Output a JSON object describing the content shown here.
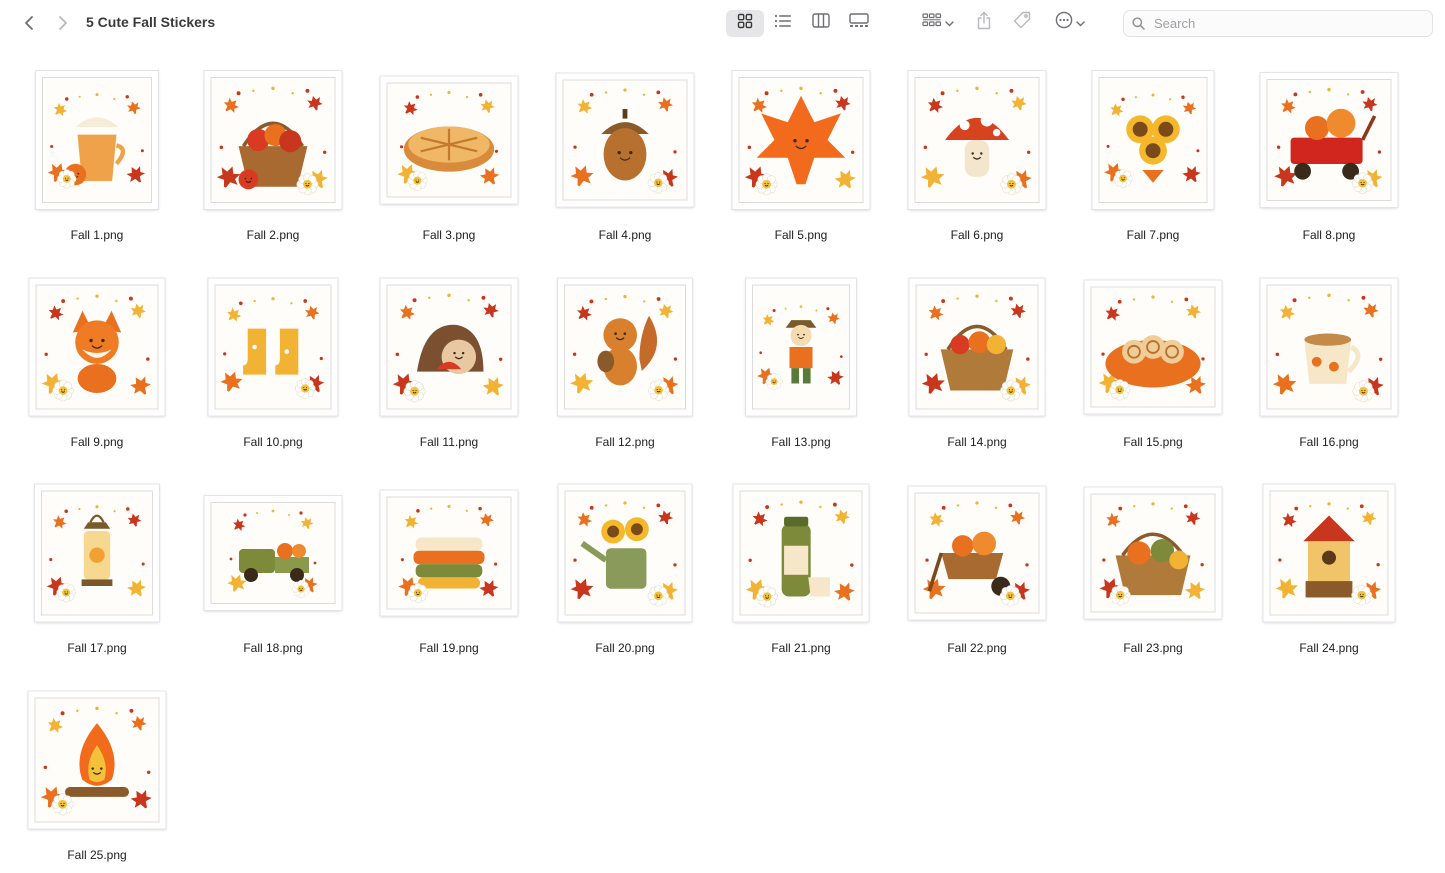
{
  "window": {
    "title": "5 Cute Fall Stickers"
  },
  "toolbar": {
    "back_icon": "chevron-left-icon",
    "forward_icon": "chevron-right-icon",
    "view_modes": [
      {
        "name": "icon-view",
        "icon": "grid-icon",
        "active": true
      },
      {
        "name": "list-view",
        "icon": "list-icon",
        "active": false
      },
      {
        "name": "column-view",
        "icon": "columns-icon",
        "active": false
      },
      {
        "name": "gallery-view",
        "icon": "gallery-icon",
        "active": false
      }
    ],
    "group_icon": "group-grid-icon",
    "share_icon": "share-icon",
    "tag_icon": "tag-icon",
    "more_icon": "ellipsis-circle-icon"
  },
  "search": {
    "placeholder": "Search",
    "value": ""
  },
  "colors": {
    "accent": "#e8862a",
    "selected_view_bg": "#e6e6e8",
    "leaf_orange": "#e8701e",
    "leaf_red": "#c8361e",
    "leaf_yellow": "#f2b233",
    "green": "#7c8a3a",
    "brown": "#8a5a2b",
    "cream": "#f6e7c8"
  },
  "files": [
    {
      "name": "Fall 1.png",
      "motif": "latte",
      "icon": "mug-icon",
      "w": 122,
      "h": 138
    },
    {
      "name": "Fall 2.png",
      "motif": "apples",
      "icon": "apple-basket-icon",
      "w": 137,
      "h": 138
    },
    {
      "name": "Fall 3.png",
      "motif": "pie",
      "icon": "pie-icon",
      "w": 137,
      "h": 127
    },
    {
      "name": "Fall 4.png",
      "motif": "acorn",
      "icon": "acorn-icon",
      "w": 137,
      "h": 133
    },
    {
      "name": "Fall 5.png",
      "motif": "leaf",
      "icon": "maple-leaf-icon",
      "w": 137,
      "h": 138
    },
    {
      "name": "Fall 6.png",
      "motif": "mushroom",
      "icon": "mushroom-icon",
      "w": 137,
      "h": 138
    },
    {
      "name": "Fall 7.png",
      "motif": "sunflowers",
      "icon": "sunflower-icon",
      "w": 121,
      "h": 138
    },
    {
      "name": "Fall 8.png",
      "motif": "wagon",
      "icon": "wagon-icon",
      "w": 137,
      "h": 134
    },
    {
      "name": "Fall 9.png",
      "motif": "fox",
      "icon": "fox-icon",
      "w": 135,
      "h": 137
    },
    {
      "name": "Fall 10.png",
      "motif": "boots",
      "icon": "boots-icon",
      "w": 129,
      "h": 137
    },
    {
      "name": "Fall 11.png",
      "motif": "hedgehog",
      "icon": "hedgehog-icon",
      "w": 137,
      "h": 137
    },
    {
      "name": "Fall 12.png",
      "motif": "squirrel",
      "icon": "squirrel-icon",
      "w": 134,
      "h": 137
    },
    {
      "name": "Fall 13.png",
      "motif": "scarecrow",
      "icon": "scarecrow-icon",
      "w": 110,
      "h": 137
    },
    {
      "name": "Fall 14.png",
      "motif": "basket",
      "icon": "harvest-basket-icon",
      "w": 135,
      "h": 137
    },
    {
      "name": "Fall 15.png",
      "motif": "rolls",
      "icon": "cinnamon-roll-icon",
      "w": 137,
      "h": 133
    },
    {
      "name": "Fall 16.png",
      "motif": "cocoa",
      "icon": "cup-icon",
      "w": 137,
      "h": 137
    },
    {
      "name": "Fall 17.png",
      "motif": "lantern",
      "icon": "lantern-icon",
      "w": 124,
      "h": 137
    },
    {
      "name": "Fall 18.png",
      "motif": "truck",
      "icon": "truck-icon",
      "w": 137,
      "h": 114
    },
    {
      "name": "Fall 19.png",
      "motif": "blankets",
      "icon": "blanket-stack-icon",
      "w": 137,
      "h": 125
    },
    {
      "name": "Fall 20.png",
      "motif": "wateringcan",
      "icon": "watering-can-icon",
      "w": 133,
      "h": 137
    },
    {
      "name": "Fall 21.png",
      "motif": "thermos",
      "icon": "thermos-icon",
      "w": 135,
      "h": 137
    },
    {
      "name": "Fall 22.png",
      "motif": "wheelbarrow",
      "icon": "wheelbarrow-icon",
      "w": 137,
      "h": 133
    },
    {
      "name": "Fall 23.png",
      "motif": "yarn",
      "icon": "yarn-basket-icon",
      "w": 137,
      "h": 131
    },
    {
      "name": "Fall 24.png",
      "motif": "birdhouse",
      "icon": "birdhouse-icon",
      "w": 131,
      "h": 137
    },
    {
      "name": "Fall 25.png",
      "motif": "campfire",
      "icon": "campfire-icon",
      "w": 137,
      "h": 137
    }
  ]
}
